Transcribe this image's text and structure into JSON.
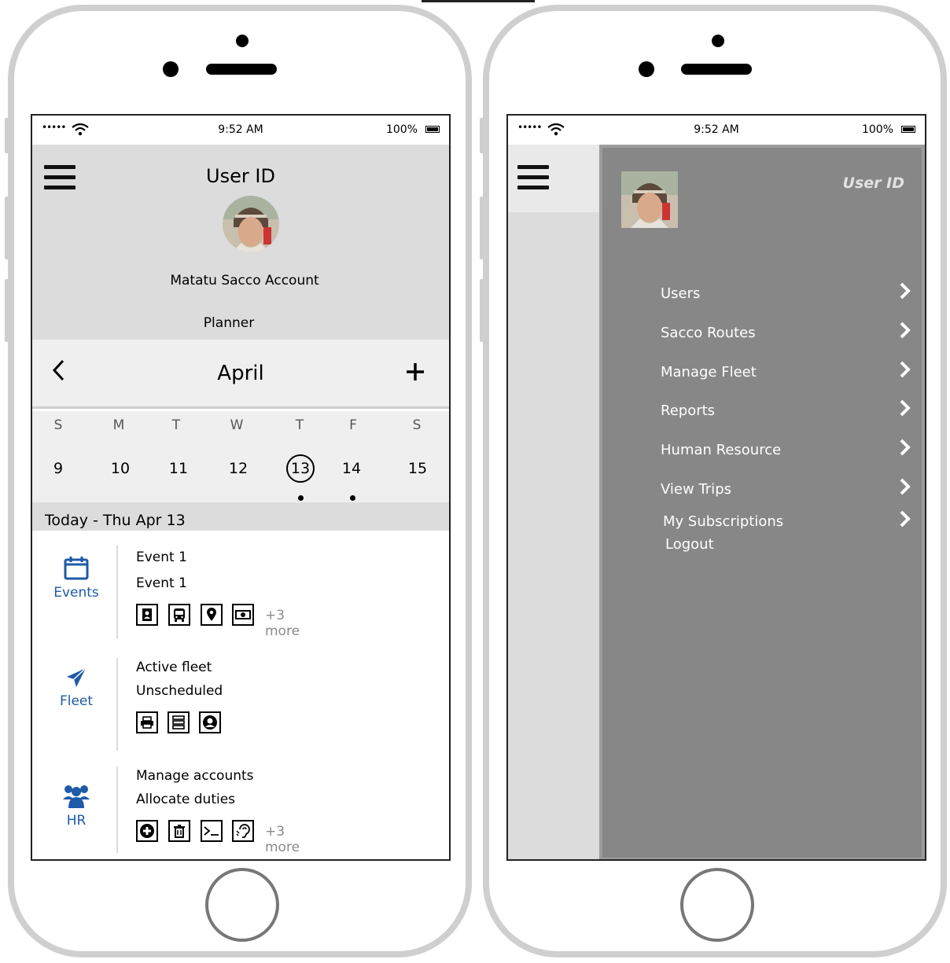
{
  "status_bar": {
    "signal": "•••••",
    "time": "9:52 AM",
    "battery": "100%"
  },
  "left_screen": {
    "header": {
      "title": "User ID",
      "account": "Matatu Sacco Account",
      "planner": "Planner"
    },
    "calendar": {
      "month": "April",
      "prev_icon": "chevron-left-icon",
      "add_icon": "plus-icon",
      "weekdays": [
        "S",
        "M",
        "T",
        "W",
        "T",
        "F",
        "S"
      ],
      "days": [
        "9",
        "10",
        "11",
        "12",
        "13",
        "14",
        "15"
      ],
      "selected_day": "13",
      "days_with_events": [
        "13",
        "14"
      ]
    },
    "today_label": "Today - Thu Apr 13",
    "sections": [
      {
        "label": "Events",
        "icon": "calendar-icon",
        "lines": [
          "Event 1",
          "Event 1"
        ],
        "actions": [
          "contact-book-icon",
          "bus-icon",
          "map-marker-icon",
          "money-icon"
        ],
        "more": "+3 more"
      },
      {
        "label": "Fleet",
        "icon": "plane-icon",
        "lines": [
          "Active fleet",
          "Unscheduled"
        ],
        "actions": [
          "print-icon",
          "server-icon",
          "user-circle-icon"
        ],
        "more": ""
      },
      {
        "label": "HR",
        "icon": "users-icon",
        "lines": [
          "Manage accounts",
          "Allocate duties"
        ],
        "actions": [
          "plus-circle-icon",
          "trash-icon",
          "terminal-icon",
          "hearing-icon"
        ],
        "more": "+3 more"
      }
    ]
  },
  "right_screen": {
    "user_id": "User ID",
    "menu": [
      {
        "label": "Users"
      },
      {
        "label": "Sacco Routes"
      },
      {
        "label": "Manage Fleet"
      },
      {
        "label": "Reports"
      },
      {
        "label": "Human Resource"
      },
      {
        "label": "View Trips"
      },
      {
        "label": "My Subscriptions"
      }
    ],
    "logout": "Logout"
  }
}
